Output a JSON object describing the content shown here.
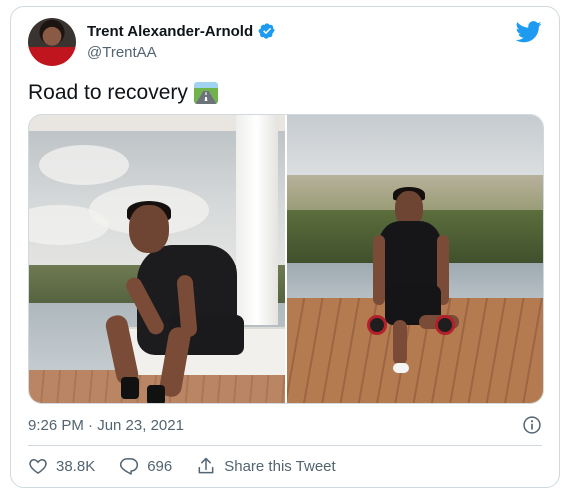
{
  "tweet": {
    "author": {
      "display_name": "Trent Alexander-Arnold",
      "handle": "@TrentAA",
      "verified": true
    },
    "text": "Road to recovery",
    "emoji": "motorway-emoji",
    "timestamp": "9:26 PM · Jun 23, 2021",
    "media_count": 2
  },
  "actions": {
    "likes_count": "38.8K",
    "replies_count": "696",
    "share_label": "Share this Tweet"
  },
  "colors": {
    "twitter_blue": "#1d9bf0",
    "text_primary": "#0f1419",
    "text_secondary": "#536471",
    "border": "#cfd9de"
  },
  "icons": [
    "verified-badge-icon",
    "twitter-bird-icon",
    "info-icon",
    "heart-icon",
    "reply-icon",
    "share-icon"
  ]
}
